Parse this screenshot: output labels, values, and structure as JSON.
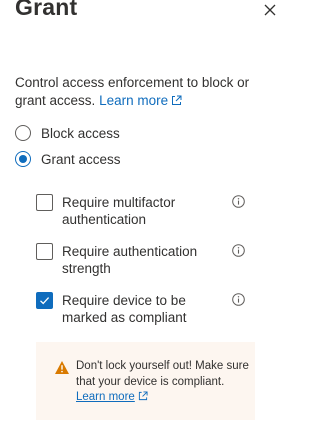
{
  "panel": {
    "title": "Grant",
    "close_icon": "close-icon"
  },
  "description": {
    "text": "Control access enforcement to block or grant access.",
    "link_text": "Learn more"
  },
  "access_options": [
    {
      "label": "Block access",
      "selected": false
    },
    {
      "label": "Grant access",
      "selected": true
    }
  ],
  "controls": [
    {
      "label": "Require multifactor authentication",
      "checked": false
    },
    {
      "label": "Require authentication strength",
      "checked": false
    },
    {
      "label": "Require device to be marked as compliant",
      "checked": true
    }
  ],
  "warning": {
    "text": "Don't lock yourself out! Make sure that your device is compliant.",
    "link_text": "Learn more"
  },
  "colors": {
    "accent": "#0f6cbd",
    "warning_icon": "#d97a00",
    "warning_bg": "#fdf6f0"
  }
}
